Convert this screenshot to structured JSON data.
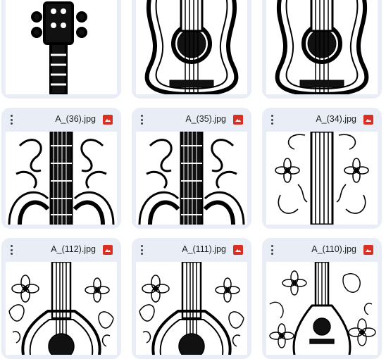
{
  "grid": {
    "rows": [
      {
        "cards": [
          {
            "file_name": "",
            "thumbnail": "guitar-headstock-drawing"
          },
          {
            "file_name": "",
            "thumbnail": "acoustic-guitar-body-drawing"
          },
          {
            "file_name": "",
            "thumbnail": "acoustic-guitar-body-drawing"
          }
        ]
      },
      {
        "cards": [
          {
            "file_name": "A_(36).jpg",
            "thumbnail": "ornamental-guitar-drawing"
          },
          {
            "file_name": "A_(35).jpg",
            "thumbnail": "ornamental-guitar-drawing"
          },
          {
            "file_name": "A_(34).jpg",
            "thumbnail": "floral-guitar-neck-drawing"
          }
        ]
      },
      {
        "cards": [
          {
            "file_name": "A_(112).jpg",
            "thumbnail": "floral-guitar-drawing"
          },
          {
            "file_name": "A_(111).jpg",
            "thumbnail": "floral-guitar-drawing"
          },
          {
            "file_name": "A_(110).jpg",
            "thumbnail": "floral-guitar-small-drawing"
          }
        ]
      }
    ]
  },
  "icons": {
    "more": "more-vert-icon",
    "file_type": "image-file-icon"
  },
  "colors": {
    "card_bg": "#e9eef6",
    "image_icon": "#d93025",
    "text": "#1f1f1f"
  }
}
